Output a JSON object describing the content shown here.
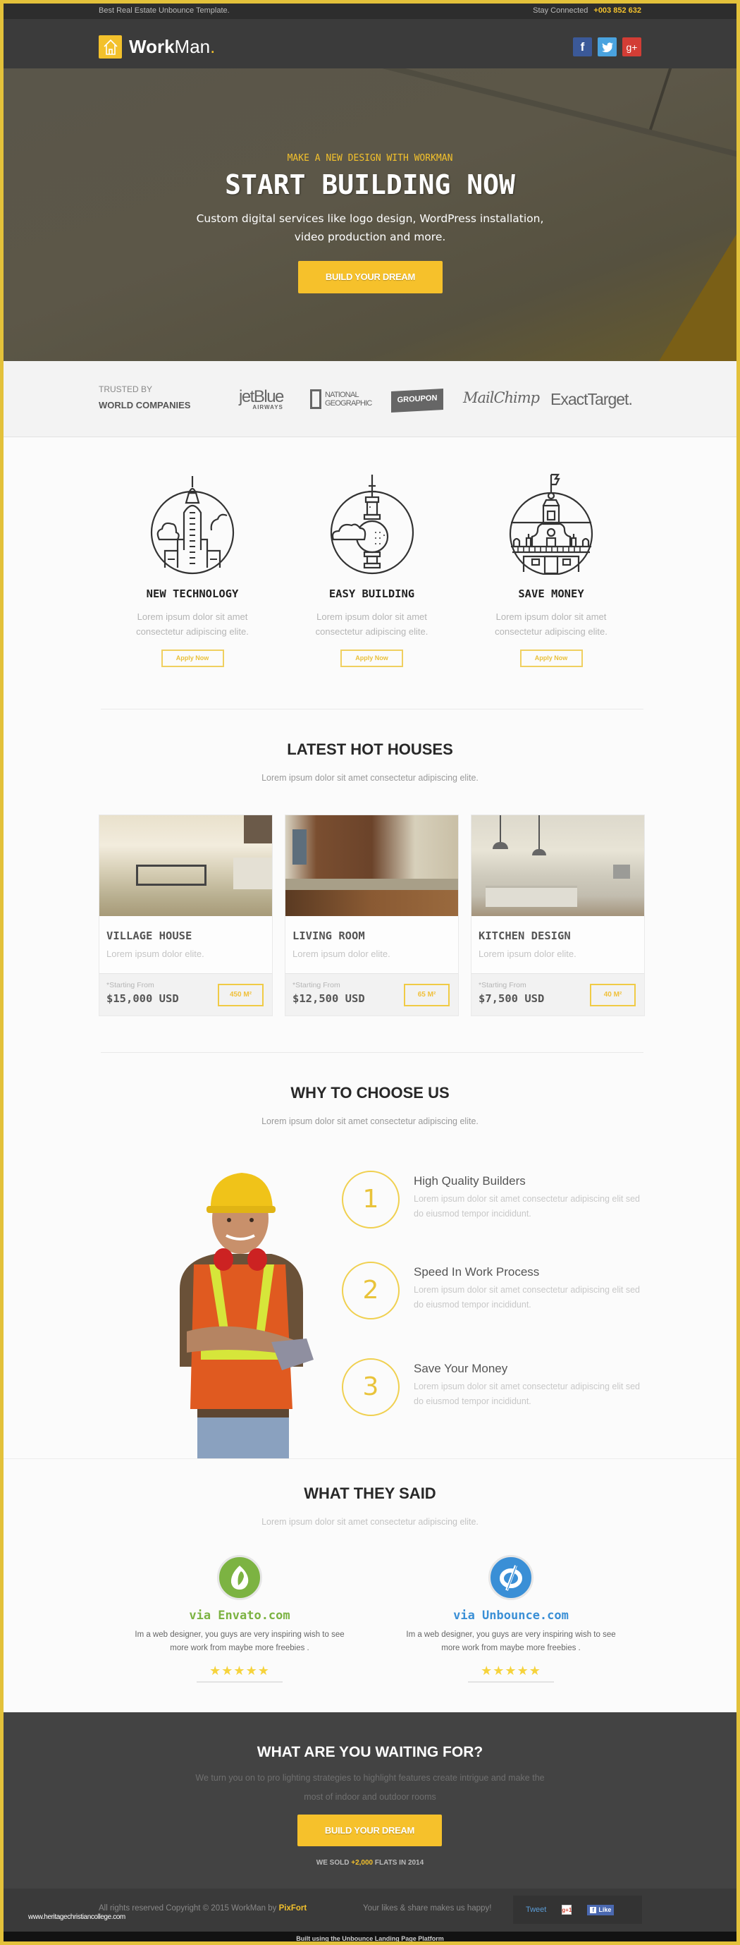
{
  "topbar": {
    "tagline": "Best Real Estate Unbounce Template.",
    "stay_connected": "Stay Connected",
    "phone": "+003 852 632"
  },
  "header": {
    "logo_bold": "Work",
    "logo_light": "Man",
    "logo_dot": ".",
    "social": [
      {
        "name": "facebook",
        "glyph": "f",
        "color": "#3b5998"
      },
      {
        "name": "twitter",
        "glyph": "t",
        "color": "#4aa3df"
      },
      {
        "name": "google-plus",
        "glyph": "g+",
        "color": "#d23d35"
      }
    ]
  },
  "hero": {
    "kicker": "MAKE A NEW DESIGN WITH WORKMAN",
    "title": "START BUILDING NOW",
    "subtitle": "Custom digital services like logo design, WordPress installation, video production and more.",
    "cta": "BUILD YOUR DREAM"
  },
  "trusted": {
    "label_top": "TRUSTED BY",
    "label_bottom": "WORLD COMPANIES",
    "brands": [
      "jetBlue AIRWAYS",
      "NATIONAL GEOGRAPHIC",
      "GROUPON",
      "MailChimp",
      "ExactTarget."
    ]
  },
  "features": [
    {
      "title": "NEW TECHNOLOGY",
      "text": "Lorem ipsum dolor sit amet consectetur adipiscing elite.",
      "button": "Apply Now",
      "icon": "skyscraper-icon"
    },
    {
      "title": "EASY BUILDING",
      "text": "Lorem ipsum dolor sit amet consectetur adipiscing elite.",
      "button": "Apply Now",
      "icon": "tv-tower-icon"
    },
    {
      "title": "SAVE MONEY",
      "text": "Lorem ipsum dolor sit amet consectetur adipiscing elite.",
      "button": "Apply Now",
      "icon": "town-hall-icon"
    }
  ],
  "houses": {
    "title": "LATEST HOT HOUSES",
    "subtitle": "Lorem ipsum dolor sit amet consectetur adipiscing elite.",
    "items": [
      {
        "name": "VILLAGE HOUSE",
        "desc": "Lorem ipsum dolor elite.",
        "starting": "*Starting From",
        "price": "$15,000 USD",
        "area": "450 M²"
      },
      {
        "name": "LIVING ROOM",
        "desc": "Lorem ipsum dolor elite.",
        "starting": "*Starting From",
        "price": "$12,500 USD",
        "area": "65 M²"
      },
      {
        "name": "KITCHEN DESIGN",
        "desc": "Lorem ipsum dolor elite.",
        "starting": "*Starting From",
        "price": "$7,500 USD",
        "area": "40 M²"
      }
    ]
  },
  "why": {
    "title": "WHY TO CHOOSE US",
    "subtitle": "Lorem ipsum dolor sit amet consectetur adipiscing elite.",
    "items": [
      {
        "num": "1",
        "title": "High Quality Builders",
        "text": "Lorem ipsum dolor sit amet consectetur adipiscing elit sed do eiusmod tempor incididunt."
      },
      {
        "num": "2",
        "title": "Speed In Work Process",
        "text": "Lorem ipsum dolor sit amet consectetur adipiscing elit sed do eiusmod tempor incididunt."
      },
      {
        "num": "3",
        "title": "Save Your Money",
        "text": "Lorem ipsum dolor sit amet consectetur adipiscing elit sed do eiusmod tempor incididunt."
      }
    ]
  },
  "testimonials": {
    "title": "WHAT THEY SAID",
    "subtitle": "Lorem ipsum dolor sit amet consectetur adipiscing elite.",
    "items": [
      {
        "source": "via Envato.com",
        "text": "Im a web designer, you guys are very inspiring wish to see more work from maybe more freebies .",
        "stars": "★★★★★",
        "rating": 5,
        "color": "#7cb342"
      },
      {
        "source": "via Unbounce.com",
        "text": "Im a web designer, you guys are very inspiring wish to see more work from maybe more freebies .",
        "stars": "★★★★★",
        "rating": 5,
        "color": "#3a8fd6"
      }
    ]
  },
  "cta": {
    "title": "WHAT ARE YOU WAITING FOR?",
    "text": "We turn you on to pro lighting strategies to highlight features create intrigue and make the most of indoor and outdoor rooms",
    "button": "BUILD YOUR DREAM",
    "sold_prefix": "WE SOLD",
    "sold_value": "+2,000",
    "sold_suffix": "FLATS IN 2014"
  },
  "footer": {
    "copyright": "All rights reserved Copyright © 2015 WorkMan by",
    "brand": "PixFort",
    "likes": "Your likes & share makes us happy!",
    "tweet": "Tweet",
    "gplus": "g+1",
    "fb_like": "Like",
    "watermark": "www.heritagechristiancollege.com",
    "built": "Built using the Unbounce Landing Page Platform"
  },
  "colors": {
    "accent": "#f3c12c",
    "dark": "#3b3b3b",
    "topbar": "#2d2d2d",
    "border": "#e3c13a"
  }
}
